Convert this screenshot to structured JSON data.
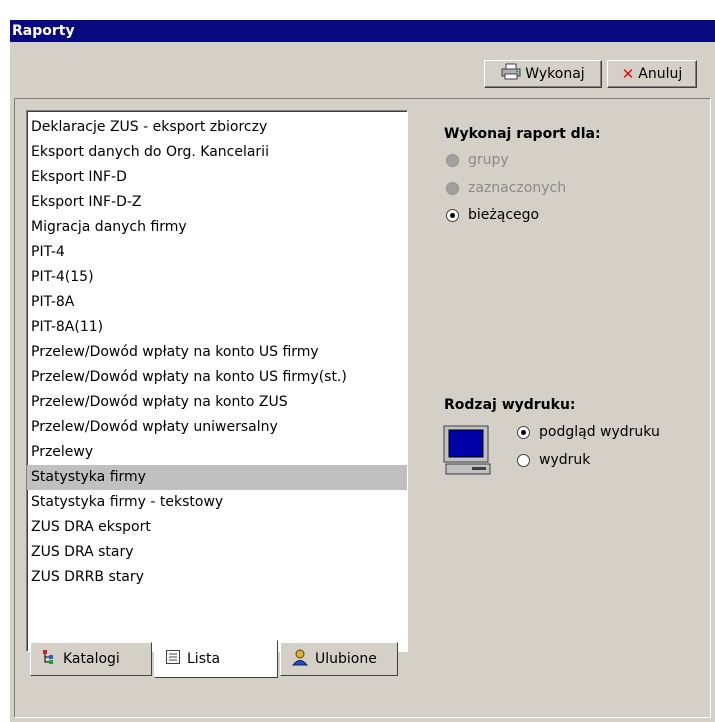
{
  "window": {
    "title": "Raporty"
  },
  "toolbar": {
    "execute_label": "Wykonaj",
    "cancel_label": "Anuluj"
  },
  "list": {
    "items": [
      "Deklaracje ZUS - eksport zbiorczy",
      "Eksport danych do Org. Kancelarii",
      "Eksport INF-D",
      "Eksport INF-D-Z",
      "Migracja danych firmy",
      "PIT-4",
      "PIT-4(15)",
      "PIT-8A",
      "PIT-8A(11)",
      "Przelew/Dowód wpłaty na konto US firmy",
      "Przelew/Dowód wpłaty na konto US firmy(st.)",
      "Przelew/Dowód wpłaty na konto ZUS",
      "Przelew/Dowód wpłaty uniwersalny",
      "Przelewy",
      "Statystyka firmy",
      "Statystyka firmy - tekstowy",
      "ZUS DRA eksport",
      "ZUS DRA stary",
      "ZUS DRRB stary"
    ],
    "selected": "Statystyka firmy"
  },
  "tabs": [
    {
      "label": "Katalogi",
      "icon": "tree-icon"
    },
    {
      "label": "Lista",
      "icon": "list-icon",
      "active": true
    },
    {
      "label": "Ulubione",
      "icon": "favorites-icon"
    }
  ],
  "scope": {
    "heading": "Wykonaj raport dla:",
    "options": [
      {
        "label": "grupy",
        "state": "disabled"
      },
      {
        "label": "zaznaczonych",
        "state": "disabled"
      },
      {
        "label": "bieżącego",
        "state": "checked"
      }
    ]
  },
  "print_type": {
    "heading": "Rodzaj wydruku:",
    "options": [
      {
        "label": "podgląd wydruku",
        "state": "checked"
      },
      {
        "label": "wydruk",
        "state": "unchecked"
      }
    ]
  },
  "colors": {
    "titlebar": "#0a0a80",
    "face": "#d4d0c8",
    "selection": "#c0c0c0",
    "cancel_icon": "#e01010"
  }
}
